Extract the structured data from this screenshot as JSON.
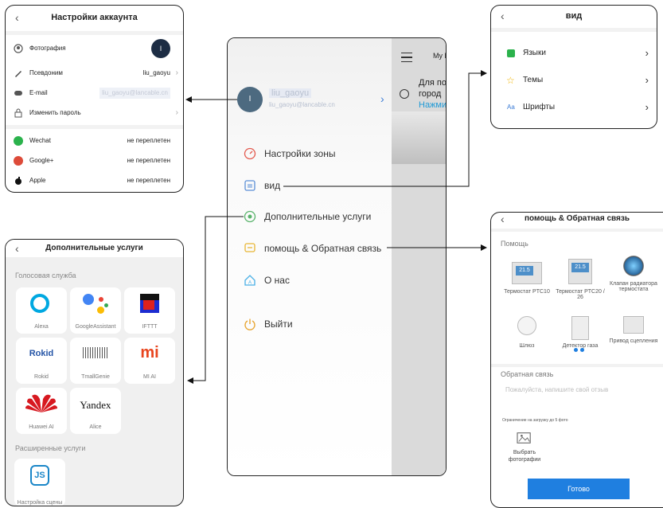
{
  "account": {
    "title": "Настройки аккаунта",
    "photo_label": "Фотография",
    "avatar_letter": "I",
    "nickname_label": "Псевдоним",
    "nickname_value": "liu_gaoyu",
    "email_label": "E-mail",
    "email_value": "liu_gaoyu@lancable.cn",
    "password_label": "Изменить пароль",
    "social": [
      {
        "label": "Wechat",
        "value": "не переплетен",
        "color": "#2bb24c"
      },
      {
        "label": "Google+",
        "value": "не переплетен",
        "color": "#dd4b39"
      },
      {
        "label": "Apple",
        "value": "не переплетен",
        "color": "#111111"
      }
    ]
  },
  "drawer": {
    "username": "liu_gaoyu",
    "email": "liu_gaoyu@lancable.cn",
    "avatar_letter": "I",
    "menu": [
      {
        "label": "Настройки зоны",
        "icon": "gauge-icon",
        "color": "#e35a4f"
      },
      {
        "label": "вид",
        "icon": "picture-frame-icon",
        "color": "#5b8fd6"
      },
      {
        "label": "Дополнительные услуги",
        "icon": "puzzle-icon",
        "color": "#59b36b"
      },
      {
        "label": "помощь & Обратная связь",
        "icon": "chat-icon",
        "color": "#e8b634"
      },
      {
        "label": "О нас",
        "icon": "home-icon",
        "color": "#4ab0e6"
      },
      {
        "label": "Выйти",
        "icon": "power-icon",
        "color": "#e8a634"
      }
    ],
    "bg_app_title": "My H",
    "bg_text1": "Для по",
    "bg_text2": "город",
    "bg_link": "Нажми"
  },
  "view": {
    "title": "вид",
    "items": [
      {
        "label": "Языки",
        "icon": "language-icon",
        "color": "#2bb24c"
      },
      {
        "label": "Темы",
        "icon": "star-icon",
        "color": "#f0b400"
      },
      {
        "label": "Шрифты",
        "icon": "font-icon",
        "color": "#3a7bd5",
        "icon_text": "Aa"
      }
    ]
  },
  "services": {
    "title": "Дополнительные услуги",
    "voice_section": "Голосовая служба",
    "voice": [
      {
        "label": "Alexa"
      },
      {
        "label": "GoogleAssistant"
      },
      {
        "label": "IFTTT"
      },
      {
        "label": "Rokid",
        "logo": "Rokid"
      },
      {
        "label": "TmallGenie"
      },
      {
        "label": "MI AI",
        "logo": "mi"
      },
      {
        "label": "Huawei AI"
      },
      {
        "label": "Alice",
        "logo": "Yandex"
      }
    ],
    "extended_section": "Расширенные услуги",
    "extended": [
      {
        "label": "Настройка сцены"
      }
    ]
  },
  "help": {
    "title": "помощь & Обратная связь",
    "help_section": "Помощь",
    "devices": [
      {
        "label": "Термостат PTC10",
        "screen": "21.5"
      },
      {
        "label": "Термостат PTC20 / 26",
        "screen": "21.5"
      },
      {
        "label": "Клапан радиатора термостата"
      },
      {
        "label": "Шлюз"
      },
      {
        "label": "Детектор газа"
      },
      {
        "label": "Привод сцепления"
      }
    ],
    "feedback_section": "Обратная связь",
    "feedback_placeholder": "Пожалуйста, напишите свой отзыв",
    "upload_limit": "Ограничение на загрузку до 5 фото",
    "choose_photo": "Выбрать фотографии",
    "done_button": "Готово",
    "accent": "#1f7fe0"
  }
}
